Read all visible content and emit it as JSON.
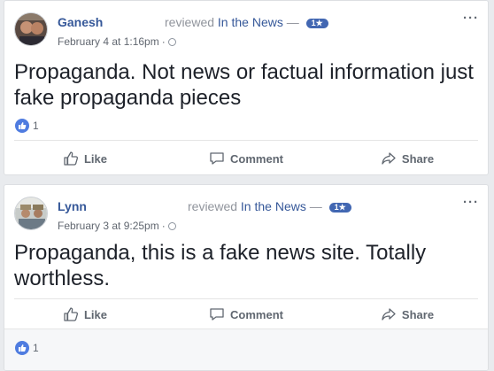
{
  "posts": [
    {
      "author": "Ganesh",
      "reviewed_text": "reviewed",
      "page_name": "In the News",
      "separator": "—",
      "rating": "1★",
      "timestamp": "February 4 at 1:16pm",
      "dot": "·",
      "text": "Propaganda. Not news or factual information just fake propaganda pieces",
      "reaction_count": "1",
      "actions": {
        "like": "Like",
        "comment": "Comment",
        "share": "Share"
      }
    },
    {
      "author": "Lynn",
      "reviewed_text": "reviewed",
      "page_name": "In the News",
      "separator": "—",
      "rating": "1★",
      "timestamp": "February 3 at 9:25pm",
      "dot": "·",
      "text": "Propaganda, this is a fake news site. Totally worthless.",
      "reaction_count": "1",
      "actions": {
        "like": "Like",
        "comment": "Comment",
        "share": "Share"
      }
    }
  ],
  "more_glyph": "···",
  "colors": {
    "link": "#365899",
    "badge": "#4267b2",
    "like": "#4f7ce0",
    "muted": "#606770"
  }
}
